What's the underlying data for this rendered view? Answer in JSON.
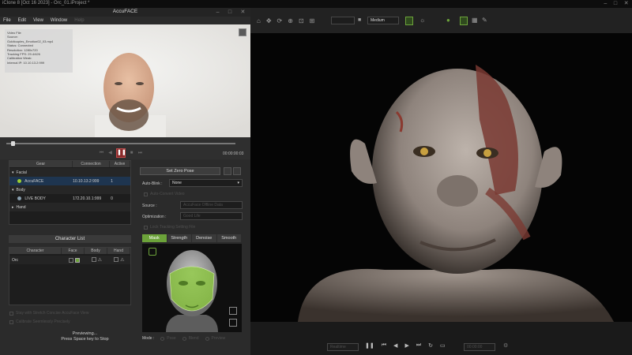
{
  "app": {
    "title": "iClone 8 [Oct 16 2023] - Orc_01.iProject *",
    "window_controls": [
      "–",
      "□",
      "✕"
    ]
  },
  "accuface": {
    "title": "AccuFACE",
    "menu": [
      "File",
      "Edit",
      "View",
      "Window",
      "Help"
    ],
    "info": {
      "l1": "Video File",
      "l2": "Source:",
      "l3": "Goldtouples_Emotion02_03.mp4",
      "l4": "Status: Connected",
      "l5": "Resolution: 1280x720",
      "l6": "Tracking FPS: 29.4/426",
      "l7": "Calibration Weak:",
      "l8": "Internal IP: 10.10.13.2:999"
    },
    "time_code": "00:00:00:03",
    "progress": 0.02
  },
  "devices": {
    "headers": [
      "Gear",
      "Connection",
      "Active"
    ],
    "rows": [
      {
        "label": "Facial",
        "type": "group"
      },
      {
        "label": "AccuFACE",
        "ip": "10.10.13.2:999",
        "active": "1",
        "type": "item",
        "status": "#9acd32"
      },
      {
        "label": "Body",
        "type": "group"
      },
      {
        "label": "LIVE BODY",
        "ip": "172.20.10.1:999",
        "active": "0",
        "type": "item",
        "status": "#8aa0b0"
      },
      {
        "label": "Hand",
        "type": "group"
      }
    ]
  },
  "controls": {
    "set_zero_pose": "Set Zero Pose",
    "auto_blink_label": "Auto-Blink :",
    "auto_blink_value": "None",
    "auto_convert_label": "Auto-Convert Video",
    "source_label": "Source :",
    "source_value": "AccuFace Offline Data",
    "optimization_label": "Optimization :",
    "optimization_value": "Good Life",
    "lock_label": "Lock Tracking Setting File"
  },
  "character_list": {
    "title": "Character List",
    "headers": [
      "Character",
      "Face",
      "Body",
      "Hand"
    ],
    "row": {
      "name": "Orc"
    },
    "opt1": "Stay with Stretch Concise AccuFace View",
    "opt2": "Calibrate Seemlessly Precisely"
  },
  "mask_tabs": [
    "Mask",
    "Strength",
    "Denoise",
    "Smooth"
  ],
  "mode": {
    "label": "Mode :",
    "options": [
      "Pose",
      "Blend",
      "Preview"
    ]
  },
  "preview": {
    "line1": "Previewing...",
    "line2": "Press Space key to Stop"
  },
  "viewport": {
    "quality": "Medium",
    "frame": "Realtime",
    "frame_num": "00:00:00"
  },
  "colors": {
    "accent_green": "#6ca33a",
    "pause_red": "#8a2a2a"
  }
}
